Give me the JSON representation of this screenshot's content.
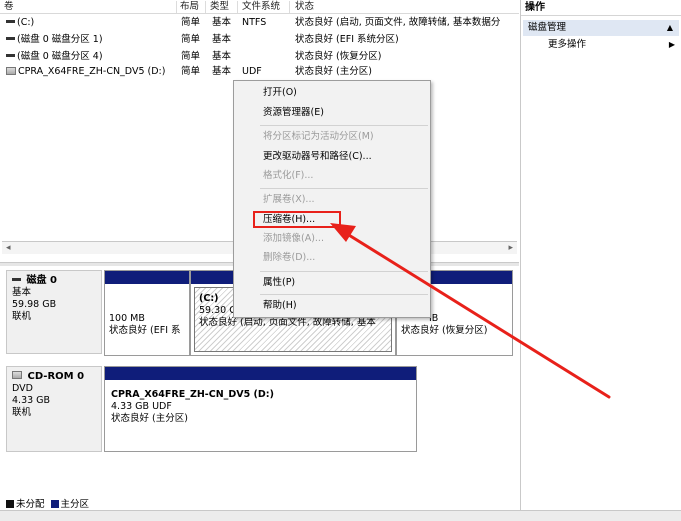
{
  "volume_list": {
    "columns": {
      "vol": "卷",
      "layout": "布局",
      "type": "类型",
      "fs": "文件系统",
      "status": "状态"
    },
    "rows": [
      {
        "name": "(C:)",
        "layout": "简单",
        "type": "基本",
        "fs": "NTFS",
        "status": "状态良好 (启动, 页面文件, 故障转储, 基本数据分"
      },
      {
        "name": "(磁盘 0 磁盘分区 1)",
        "layout": "简单",
        "type": "基本",
        "fs": "",
        "status": "状态良好 (EFI 系统分区)"
      },
      {
        "name": "(磁盘 0 磁盘分区 4)",
        "layout": "简单",
        "type": "基本",
        "fs": "",
        "status": "状态良好 (恢复分区)"
      },
      {
        "name": "CPRA_X64FRE_ZH-CN_DV5 (D:)",
        "layout": "简单",
        "type": "基本",
        "fs": "UDF",
        "status": "状态良好 (主分区)"
      }
    ]
  },
  "disk0": {
    "title": "磁盘 0",
    "kind": "基本",
    "size": "59.98 GB",
    "state": "联机",
    "partitions": [
      {
        "size": "100 MB",
        "status": "状态良好 (EFI 系"
      },
      {
        "name": "(C:)",
        "size": "59.30 G",
        "status": "状态良好 (启动, 页面文件, 故障转储, 基本"
      },
      {
        "size": "IB",
        "status": "状态良好 (恢复分区)"
      }
    ]
  },
  "cdrom0": {
    "title": "CD-ROM 0",
    "kind": "DVD",
    "size": "4.33 GB",
    "state": "联机",
    "partition": {
      "name": "CPRA_X64FRE_ZH-CN_DV5  (D:)",
      "size": "4.33 GB UDF",
      "status": "状态良好 (主分区)"
    }
  },
  "legend": {
    "unallocated": "未分配",
    "primary": "主分区"
  },
  "actions": {
    "title": "操作",
    "section": "磁盘管理",
    "more": "更多操作"
  },
  "context_menu": {
    "open": "打开(O)",
    "explorer": "资源管理器(E)",
    "mark_active": "将分区标记为活动分区(M)",
    "change_letter": "更改驱动器号和路径(C)...",
    "format": "格式化(F)...",
    "extend": "扩展卷(X)...",
    "shrink": "压缩卷(H)...",
    "add_mirror": "添加镜像(A)...",
    "delete": "删除卷(D)...",
    "properties": "属性(P)",
    "help": "帮助(H)"
  },
  "colors": {
    "primary_bar": "#0f1d7a",
    "unallocated": "#111111",
    "highlight": "#e8211a",
    "arrow": "#e8211a"
  },
  "icons": {
    "disk": "disk-icon",
    "cdrom": "cd-drive-icon"
  }
}
